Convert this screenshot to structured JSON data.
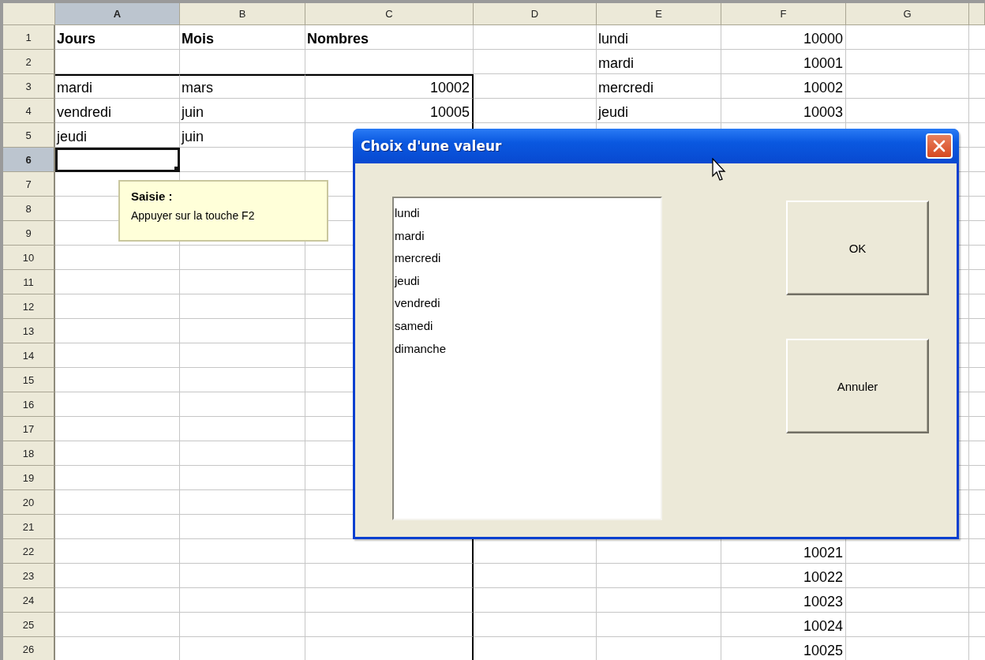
{
  "columns": [
    {
      "label": "A",
      "selected": true
    },
    {
      "label": "B",
      "selected": false
    },
    {
      "label": "C",
      "selected": false
    },
    {
      "label": "D",
      "selected": false
    },
    {
      "label": "E",
      "selected": false
    },
    {
      "label": "F",
      "selected": false
    },
    {
      "label": "G",
      "selected": false
    }
  ],
  "rows": [
    {
      "label": "1",
      "selected": false,
      "cells": [
        {
          "kind": "header",
          "text": "Jours"
        },
        {
          "kind": "header",
          "text": "Mois"
        },
        {
          "kind": "header",
          "text": "Nombres"
        },
        {},
        {
          "kind": "text",
          "text": "lundi"
        },
        {
          "kind": "number",
          "text": "10000"
        },
        {}
      ]
    },
    {
      "label": "2",
      "selected": false,
      "cells": [
        {},
        {},
        {},
        {},
        {
          "kind": "text",
          "text": "mardi"
        },
        {
          "kind": "number",
          "text": "10001"
        },
        {}
      ]
    },
    {
      "label": "3",
      "selected": false,
      "cells": [
        {
          "kind": "text",
          "text": "mardi",
          "border_top": true
        },
        {
          "kind": "text",
          "text": "mars",
          "border_top": true
        },
        {
          "kind": "number",
          "text": "10002",
          "border_top": true,
          "border_right": true
        },
        {},
        {
          "kind": "text",
          "text": "mercredi"
        },
        {
          "kind": "number",
          "text": "10002"
        },
        {}
      ]
    },
    {
      "label": "4",
      "selected": false,
      "cells": [
        {
          "kind": "text",
          "text": "vendredi"
        },
        {
          "kind": "text",
          "text": "juin"
        },
        {
          "kind": "number",
          "text": "10005",
          "border_right": true
        },
        {},
        {
          "kind": "text",
          "text": "jeudi"
        },
        {
          "kind": "number",
          "text": "10003"
        },
        {}
      ]
    },
    {
      "label": "5",
      "selected": false,
      "cells": [
        {
          "kind": "text",
          "text": "jeudi"
        },
        {
          "kind": "text",
          "text": "juin"
        },
        {
          "border_right": true
        },
        {},
        {},
        {},
        {}
      ]
    },
    {
      "label": "6",
      "selected": true,
      "cells": [
        {},
        {},
        {},
        {},
        {},
        {},
        {}
      ]
    },
    {
      "label": "7",
      "selected": false,
      "cells": [
        {},
        {},
        {},
        {},
        {},
        {},
        {}
      ]
    },
    {
      "label": "8",
      "selected": false,
      "cells": [
        {},
        {},
        {},
        {},
        {},
        {},
        {}
      ]
    },
    {
      "label": "9",
      "selected": false,
      "cells": [
        {},
        {},
        {},
        {},
        {},
        {},
        {}
      ]
    },
    {
      "label": "10",
      "selected": false,
      "cells": [
        {},
        {},
        {},
        {},
        {},
        {},
        {}
      ]
    },
    {
      "label": "11",
      "selected": false,
      "cells": [
        {},
        {},
        {},
        {},
        {},
        {},
        {}
      ]
    },
    {
      "label": "12",
      "selected": false,
      "cells": [
        {},
        {},
        {},
        {},
        {},
        {},
        {}
      ]
    },
    {
      "label": "13",
      "selected": false,
      "cells": [
        {},
        {},
        {},
        {},
        {},
        {},
        {}
      ]
    },
    {
      "label": "14",
      "selected": false,
      "cells": [
        {},
        {},
        {},
        {},
        {},
        {},
        {}
      ]
    },
    {
      "label": "15",
      "selected": false,
      "cells": [
        {},
        {},
        {},
        {},
        {},
        {},
        {}
      ]
    },
    {
      "label": "16",
      "selected": false,
      "cells": [
        {},
        {},
        {},
        {},
        {},
        {},
        {}
      ]
    },
    {
      "label": "17",
      "selected": false,
      "cells": [
        {},
        {},
        {},
        {},
        {},
        {},
        {}
      ]
    },
    {
      "label": "18",
      "selected": false,
      "cells": [
        {},
        {},
        {},
        {},
        {},
        {},
        {}
      ]
    },
    {
      "label": "19",
      "selected": false,
      "cells": [
        {},
        {},
        {},
        {},
        {},
        {},
        {}
      ]
    },
    {
      "label": "20",
      "selected": false,
      "cells": [
        {},
        {},
        {},
        {},
        {},
        {},
        {}
      ]
    },
    {
      "label": "21",
      "selected": false,
      "cells": [
        {},
        {},
        {},
        {},
        {},
        {},
        {}
      ]
    },
    {
      "label": "22",
      "selected": false,
      "cells": [
        {},
        {},
        {
          "border_right": true
        },
        {},
        {},
        {
          "kind": "number",
          "text": "10021"
        },
        {}
      ]
    },
    {
      "label": "23",
      "selected": false,
      "cells": [
        {},
        {},
        {
          "border_right": true
        },
        {},
        {},
        {
          "kind": "number",
          "text": "10022"
        },
        {}
      ]
    },
    {
      "label": "24",
      "selected": false,
      "cells": [
        {},
        {},
        {
          "border_right": true
        },
        {},
        {},
        {
          "kind": "number",
          "text": "10023"
        },
        {}
      ]
    },
    {
      "label": "25",
      "selected": false,
      "cells": [
        {},
        {},
        {
          "border_right": true
        },
        {},
        {},
        {
          "kind": "number",
          "text": "10024"
        },
        {}
      ]
    },
    {
      "label": "26",
      "selected": false,
      "cells": [
        {},
        {},
        {
          "border_right": true
        },
        {},
        {},
        {
          "kind": "number",
          "text": "10025"
        },
        {}
      ]
    }
  ],
  "tooltip": {
    "title": "Saisie :",
    "text": "Appuyer sur la touche F2"
  },
  "dialog": {
    "title": "Choix d'une valeur",
    "list_items": [
      {
        "text": "lundi",
        "selected": false
      },
      {
        "text": "mardi",
        "selected": false
      },
      {
        "text": "mercredi",
        "selected": false
      },
      {
        "text": "jeudi",
        "selected": false
      },
      {
        "text": "vendredi",
        "selected": false
      },
      {
        "text": "samedi",
        "selected": false
      },
      {
        "text": "dimanche",
        "selected": false
      }
    ],
    "buttons": [
      "OK",
      "Annuler"
    ]
  }
}
